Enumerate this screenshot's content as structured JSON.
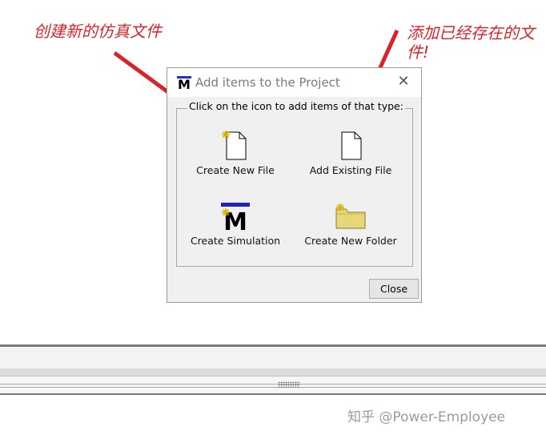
{
  "annotations": {
    "new_file_note": "创建新的仿真文件",
    "existing_file_note": "添加已经存在的文件!"
  },
  "dialog": {
    "title": "Add items to the Project",
    "title_icon": "modelsim-m-icon",
    "group_label": "Click on the icon to add items of that type:",
    "items": [
      {
        "label": "Create New File",
        "icon": "new-file-icon"
      },
      {
        "label": "Add Existing File",
        "icon": "file-icon"
      },
      {
        "label": "Create Simulation",
        "icon": "modelsim-m-icon"
      },
      {
        "label": "Create New Folder",
        "icon": "new-folder-icon"
      }
    ],
    "close_label": "Close"
  },
  "colors": {
    "annotation_red": "#d8232a",
    "dialog_bg": "#f0f0f0",
    "m_bar_blue": "#2b2fb8",
    "folder_yellow": "#e8d77a"
  },
  "watermark": "知乎 @Power-Employee"
}
